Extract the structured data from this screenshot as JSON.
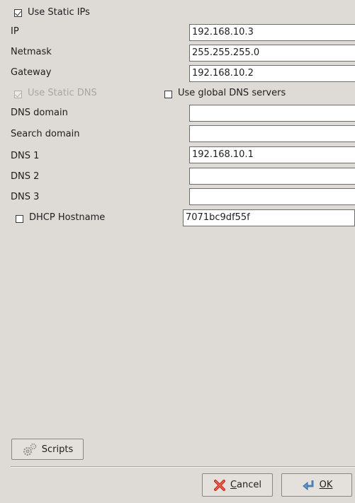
{
  "use_static_ips": {
    "label": "Use Static IPs",
    "checked": true
  },
  "fields": {
    "ip": {
      "label": "IP",
      "value": "192.168.10.3"
    },
    "netmask": {
      "label": "Netmask",
      "value": "255.255.255.0"
    },
    "gateway": {
      "label": "Gateway",
      "value": "192.168.10.2"
    },
    "dns_domain": {
      "label": "DNS domain",
      "value": ""
    },
    "search_domain": {
      "label": "Search domain",
      "value": ""
    },
    "dns1": {
      "label": "DNS 1",
      "value": "192.168.10.1"
    },
    "dns2": {
      "label": "DNS 2",
      "value": ""
    },
    "dns3": {
      "label": "DNS 3",
      "value": ""
    },
    "dhcp_hostname": {
      "label": "DHCP Hostname",
      "value": "7071bc9df55f",
      "checked": false
    }
  },
  "use_static_dns": {
    "label": "Use Static DNS",
    "checked": true,
    "enabled": false
  },
  "use_global_dns": {
    "label": "Use global DNS servers",
    "checked": false
  },
  "buttons": {
    "scripts": "Scripts",
    "cancel_rest": "ancel",
    "cancel_mnemonic": "C",
    "ok": "OK"
  }
}
